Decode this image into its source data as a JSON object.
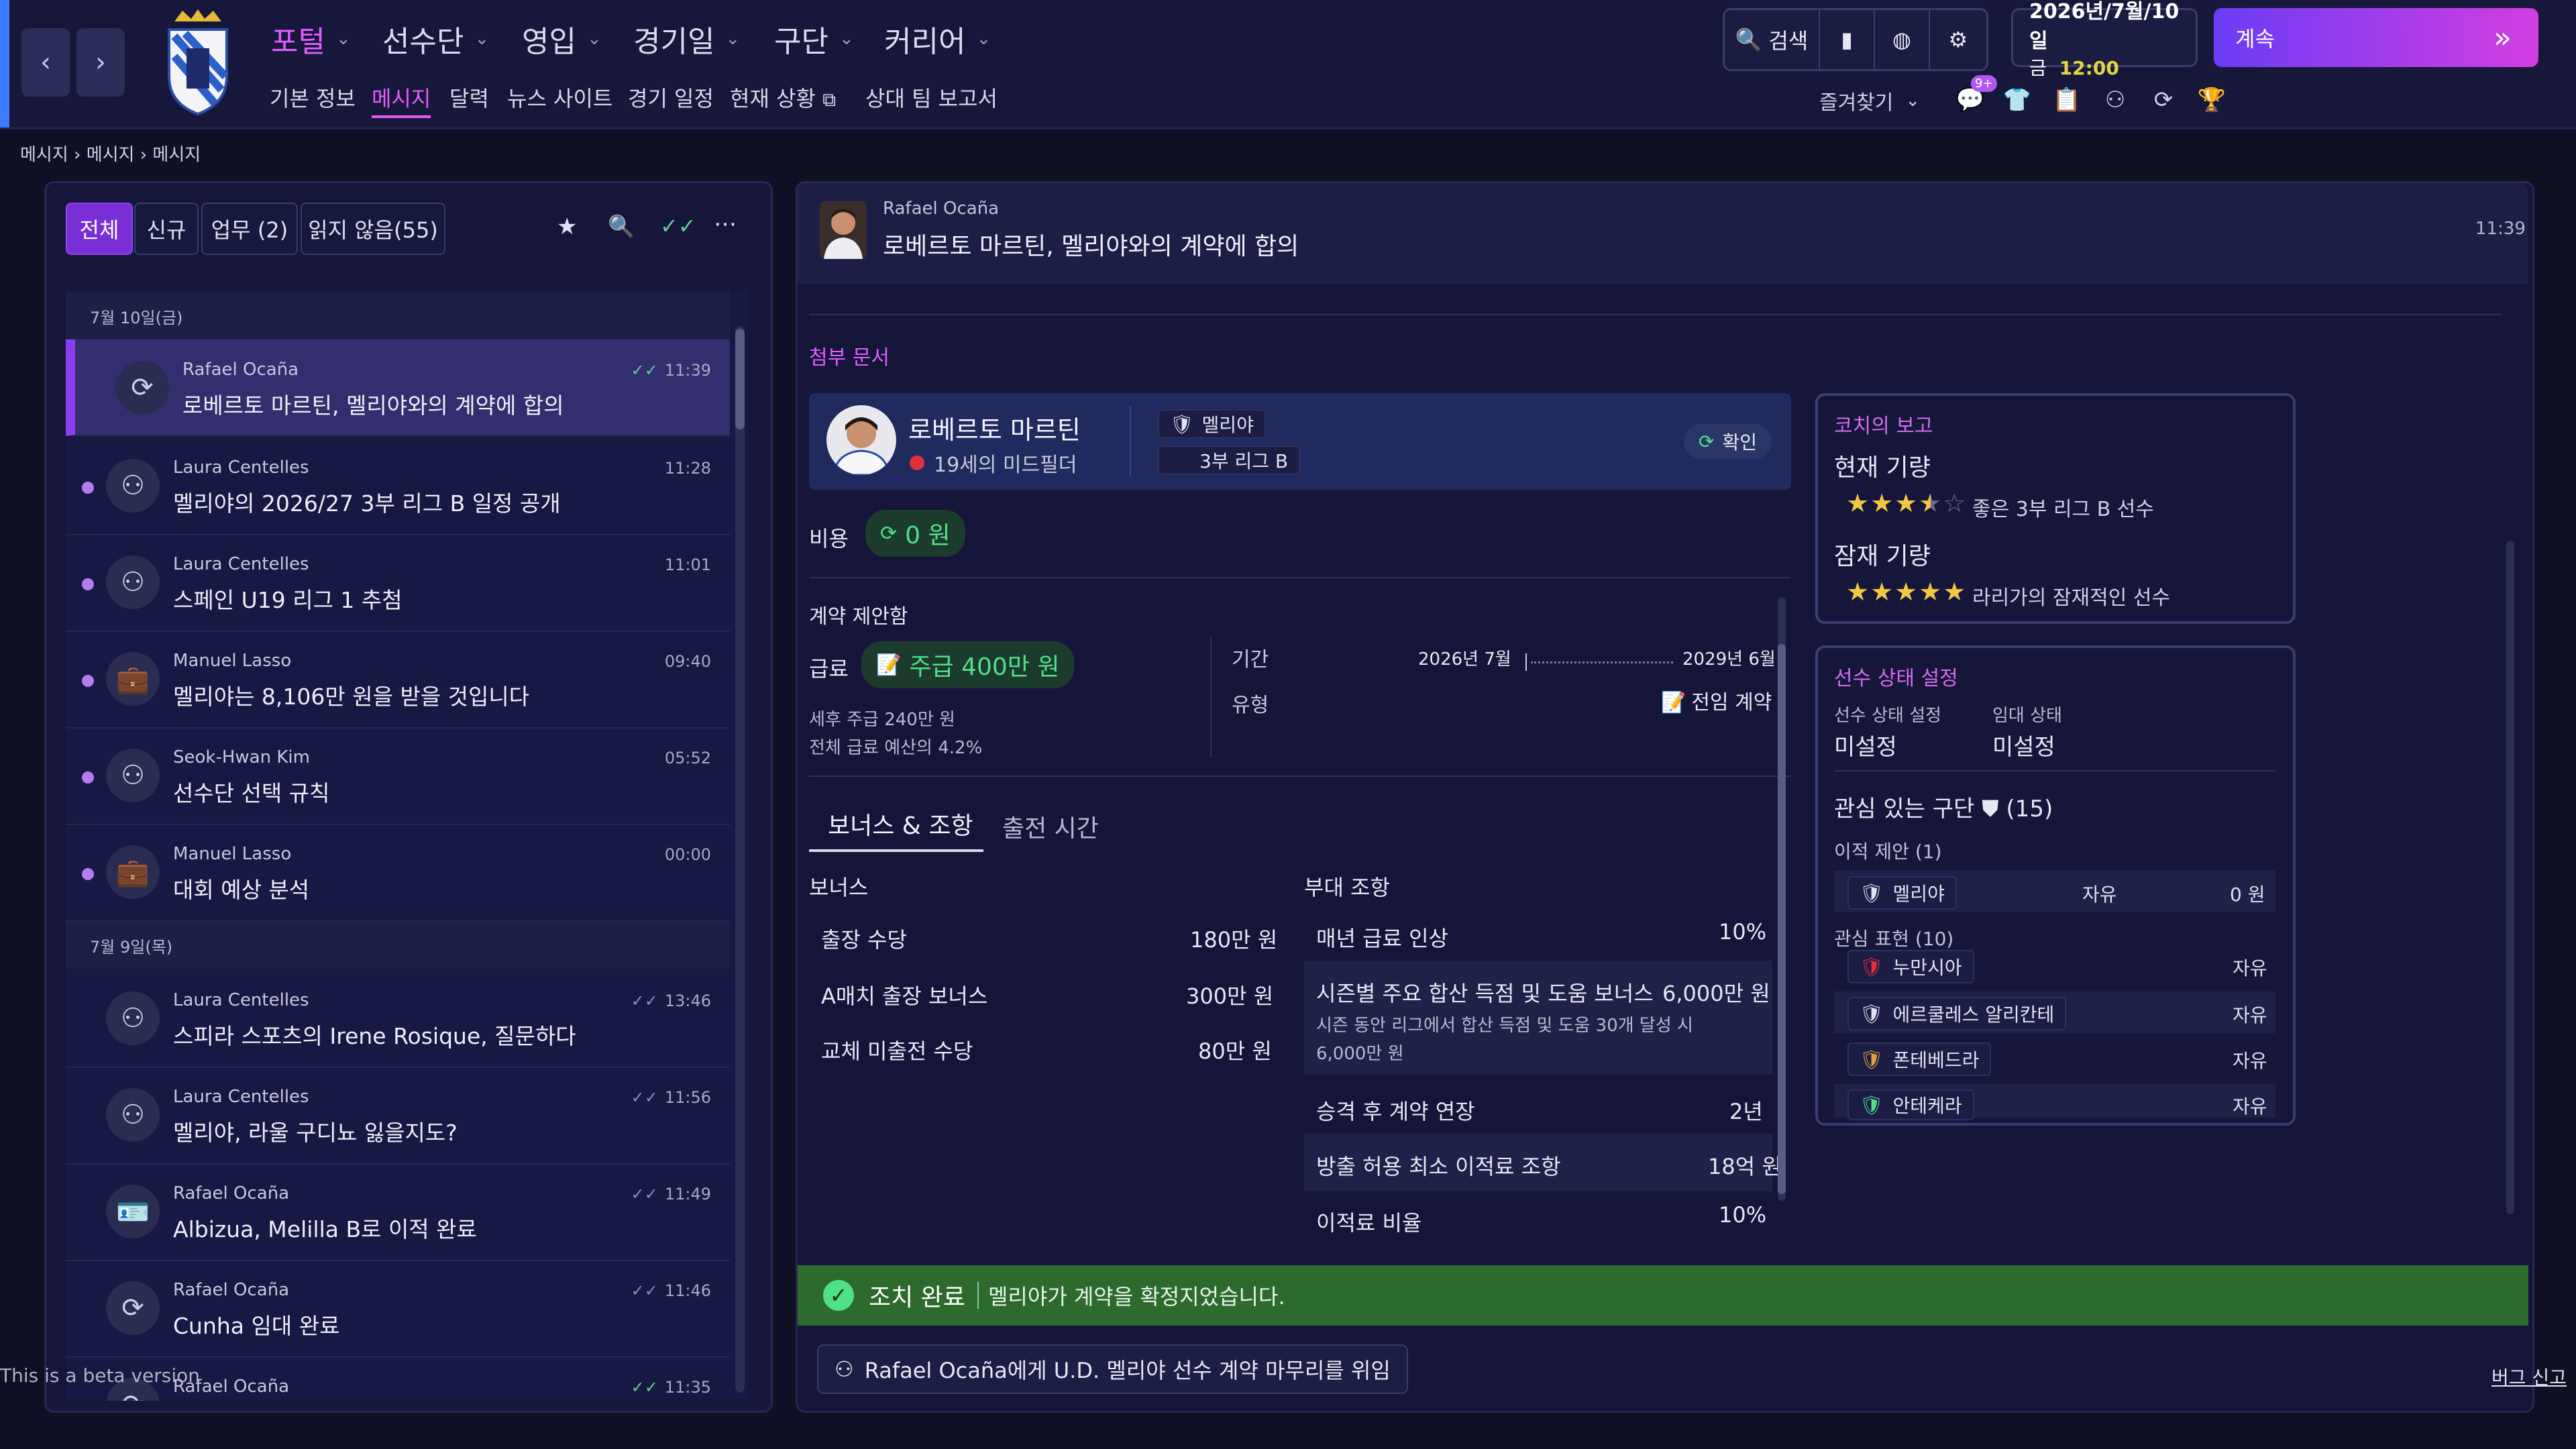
{
  "topbar": {
    "menu": [
      "포털",
      "선수단",
      "영입",
      "경기일",
      "구단",
      "커리어"
    ],
    "submenu": [
      "기본 정보",
      "메시지",
      "달력",
      "뉴스 사이트",
      "경기 일정",
      "현재 상황",
      "상대 팀 보고서"
    ],
    "search_label": "검색",
    "date_line1": "2026년/7월/10일",
    "date_day": "금",
    "date_time": "12:00",
    "continue_label": "계속",
    "favorites_label": "즐겨찾기",
    "badge_count": "9+"
  },
  "breadcrumb": [
    "메시지",
    "메시지",
    "메시지"
  ],
  "inbox": {
    "filters": [
      "전체",
      "신규",
      "업무 (2)",
      "읽지 않음(55)"
    ],
    "groups": [
      {
        "date": "7월 10일(금)"
      },
      {
        "date": "7월 9일(목)"
      }
    ],
    "messages": [
      {
        "sender": "Rafael Ocaña",
        "subject": "로베르토 마르틴, 멜리야와의 계약에 합의",
        "time": "11:39"
      },
      {
        "sender": "Laura Centelles",
        "subject": "멜리야의 2026/27 3부 리그 B 일정 공개",
        "time": "11:28"
      },
      {
        "sender": "Laura Centelles",
        "subject": "스페인 U19 리그 1 추첨",
        "time": "11:01"
      },
      {
        "sender": "Manuel Lasso",
        "subject": "멜리야는 8,106만 원을 받을 것입니다",
        "time": "09:40"
      },
      {
        "sender": "Seok-Hwan Kim",
        "subject": "선수단 선택 규칙",
        "time": "05:52"
      },
      {
        "sender": "Manuel Lasso",
        "subject": "대회 예상 분석",
        "time": "00:00"
      },
      {
        "sender": "Laura Centelles",
        "subject": "스피라 스포츠의 Irene Rosique, 질문하다",
        "time": "13:46"
      },
      {
        "sender": "Laura Centelles",
        "subject": "멜리야, 라울 구디뇨 잃을지도?",
        "time": "11:56"
      },
      {
        "sender": "Rafael Ocaña",
        "subject": "Albizua, Melilla B로 이적 완료",
        "time": "11:49"
      },
      {
        "sender": "Rafael Ocaña",
        "subject": "Cunha 임대 완료",
        "time": "11:46"
      },
      {
        "sender": "Rafael Ocaña",
        "subject": "",
        "time": "11:35"
      }
    ],
    "beta_note": "This is a beta version"
  },
  "message": {
    "sender": "Rafael Ocaña",
    "title": "로베르토 마르틴, 멜리야와의 계약에 합의",
    "time": "11:39",
    "attachments_label": "첨부 문서",
    "player_name": "로베르토 마르틴",
    "player_desc": "19세의 미드필더",
    "club": "멜리야",
    "league": "3부 리그 B",
    "confirm_label": "확인",
    "cost_label": "비용",
    "cost_value": "0 원",
    "proposal_label": "계약 제안함",
    "wage_label": "급료",
    "wage_value": "주급 400만 원",
    "after_tax": "세후 주급 240만 원",
    "budget_pct": "전체 급료 예산의 4.2%",
    "period_label": "기간",
    "period_start": "2026년 7월",
    "period_end": "2029년 6월",
    "type_label": "유형",
    "type_value": "전임 계약",
    "tabs": [
      "보너스 & 조항",
      "출전 시간"
    ],
    "bonus_header": "보너스",
    "bonuses": [
      {
        "name": "출장 수당",
        "value": "180만 원"
      },
      {
        "name": "A매치 출장 보너스",
        "value": "300만 원"
      },
      {
        "name": "교체 미출전 수당",
        "value": "80만 원"
      }
    ],
    "clause_header": "부대 조항",
    "clauses": [
      {
        "name": "매년 급료 인상",
        "value": "10%"
      },
      {
        "name": "시즌별 주요 합산 득점 및 도움 보너스",
        "value": "6,000만 원",
        "note": "시즌 동안 리그에서 합산 득점 및 도움 30개 달성 시 6,000만 원"
      },
      {
        "name": "승격 후 계약 연장",
        "value": "2년"
      },
      {
        "name": "방출 허용 최소 이적료 조항",
        "value": "18억 원"
      },
      {
        "name": "이적료 비율",
        "value": "10%"
      }
    ],
    "done_label": "조치 완료",
    "done_text": "멜리야가 계약을 확정지었습니다.",
    "delegate_label": "Rafael Ocaña에게 U.D. 멜리야 선수 계약 마무리를 위임",
    "bug_report": "버그 신고"
  },
  "coach_report": {
    "title": "코치의 보고",
    "current_label": "현재 기량",
    "current_text": "좋은 3부 리그 B 선수",
    "current_stars": 3.5,
    "potential_label": "잠재 기량",
    "potential_text": "라리가의 잠재적인 선수",
    "potential_stars": 5
  },
  "status_card": {
    "title": "선수 상태 설정",
    "status_label": "선수 상태 설정",
    "status_value": "미설정",
    "loan_label": "임대 상태",
    "loan_value": "미설정",
    "interested_label": "관심 있는 구단",
    "interested_count": "(15)",
    "offers_label": "이적 제안 (1)",
    "offer": {
      "club": "멜리야",
      "status": "자유",
      "fee": "0 원"
    },
    "interest_label": "관심 표현 (10)",
    "interests": [
      {
        "club": "누만시아",
        "status": "자유"
      },
      {
        "club": "에르쿨레스 알리칸테",
        "status": "자유"
      },
      {
        "club": "폰테베드라",
        "status": "자유"
      },
      {
        "club": "안테케라",
        "status": "자유"
      }
    ]
  },
  "colors": {
    "accent": "#e35cff",
    "green": "#4fe088",
    "bg": "#0f1024",
    "panel": "#15163a"
  }
}
